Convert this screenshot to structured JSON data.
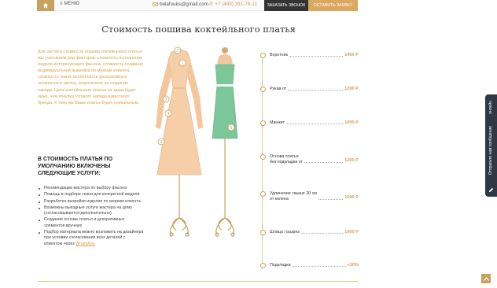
{
  "topbar": {
    "menu_label": "МЕНЮ",
    "email": "belafouks@gmail.com",
    "phone": "+7 (499) 391-78-11",
    "call_button": "ЗАКАЗАТЬ ЗВОНОК",
    "order_button": "ОСТАВИТЬ ЗАЯВКУ"
  },
  "page_title": "Стоимость пошива коктейльного платья",
  "intro_text": "Для расчета стоимости пошива коктейльного платья мы учитываем ряд факторов: сложность исполнения модели интересующего фасона, сложность создания индивидуальной выкройки по меркам клиента, сложность ткани, особенности декоративных элементов и шелка, затраченное на создание наряда. Цена коктейльного платья на заказ будет ниже, чем покупка готового наряда известного бренда. К тому же Ваше платье будет уникальным.",
  "included": {
    "title": "В СТОИМОСТЬ ПЛАТЬЯ ПО УМОЛЧАНИЮ ВКЛЮЧЕНЫ СЛЕДУЮЩИЕ УСЛУГИ:",
    "items": [
      "Рекомендации мастера по выбору фасона",
      "Помощь в подборе ткани для конкретной модели",
      "Разработка выкройки изделия по меркам клиента",
      "Возможны выездные услуги мастера на дому (согласовываются дополнительно)",
      "Создание основы платья и декоративных элементов вручную"
    ],
    "last_item_text": "Подбор материала можно возложить на дизайнера при условии согласования всех деталей с клиентом через ",
    "last_item_link": "WhatsApp"
  },
  "illustration": {
    "markers": [
      "1",
      "2",
      "3",
      "4",
      "5",
      "6"
    ]
  },
  "prices": [
    {
      "name": "Воротник",
      "value": "1400 Р"
    },
    {
      "name": "Рукав от",
      "value": "1200 Р"
    },
    {
      "name": "Манжет",
      "value": "1000 Р"
    },
    {
      "name": "Основа платья\nбез подкладки от",
      "value": "1200 Р"
    },
    {
      "name": "Удлинение свыше 20 см\nот колена",
      "value": "1500 Р"
    },
    {
      "name": "Шлица / разрез",
      "value": "1000 Р"
    },
    {
      "name": "Подкладка",
      "value": "+30%"
    }
  ],
  "side_widget": {
    "label_online": "онлайн",
    "label_send": "Отправьте нам сообщение"
  },
  "colors": {
    "accent": "#c9a15e",
    "dark": "#333333",
    "dress_left": "#f6cfa8",
    "dress_right": "#7cc79a"
  }
}
